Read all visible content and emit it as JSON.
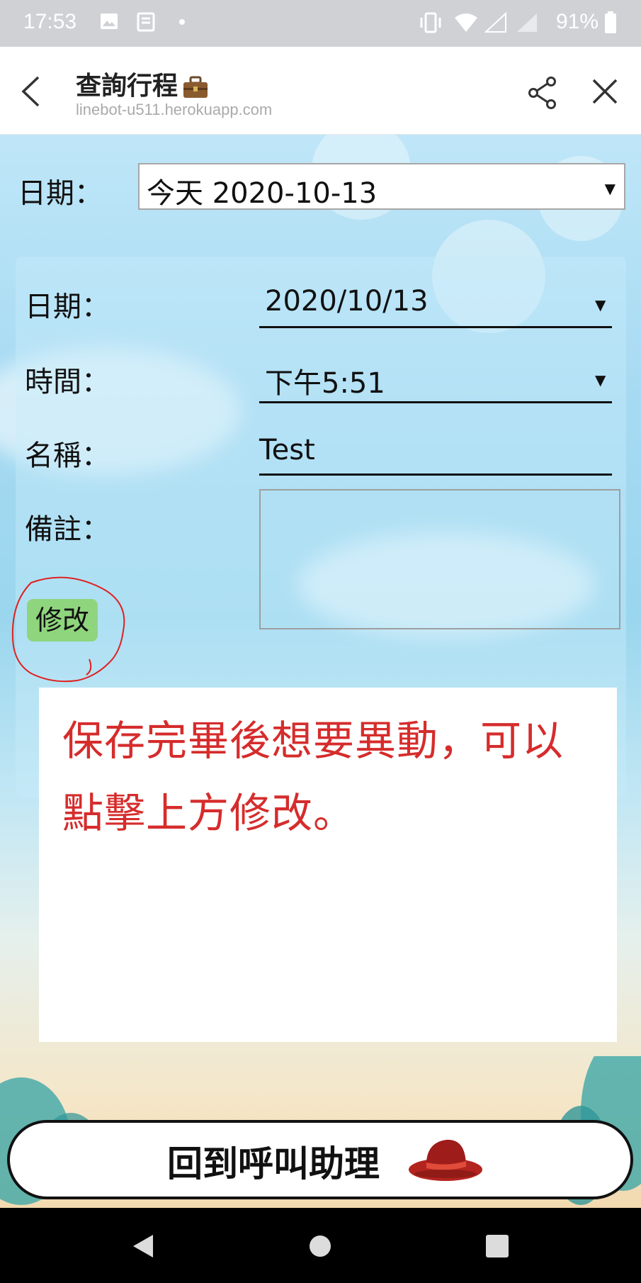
{
  "status_bar": {
    "time": "17:53",
    "battery": "91%",
    "icons": [
      "image-icon",
      "news-icon",
      "dot-icon",
      "vibrate-icon",
      "wifi-icon",
      "signal-icon",
      "signal-icon",
      "battery-icon"
    ]
  },
  "header": {
    "title": "查詢行程",
    "url": "linebot-u511.herokuapp.com",
    "back_icon": "chevron-left-icon",
    "share_icon": "share-icon",
    "close_icon": "close-icon"
  },
  "date_filter": {
    "label": "日期：",
    "selected": "今天 2020-10-13",
    "arrow": "▼"
  },
  "form": {
    "date_label": "日期：",
    "date_value": "2020/10/13",
    "time_label": "時間：",
    "time_value": "下午5:51",
    "name_label": "名稱：",
    "name_value": "Test",
    "notes_label": "備註：",
    "notes_value": "",
    "arrow": "▼",
    "edit_button": "修改"
  },
  "tip": {
    "text": "保存完畢後想要異動，可以點擊上方修改。"
  },
  "assistant_button": {
    "label": "回到呼叫助理"
  },
  "colors": {
    "edit_button_bg": "#8fd57d",
    "tip_text": "#d62c2c",
    "annotation_circle": "#e02020"
  }
}
